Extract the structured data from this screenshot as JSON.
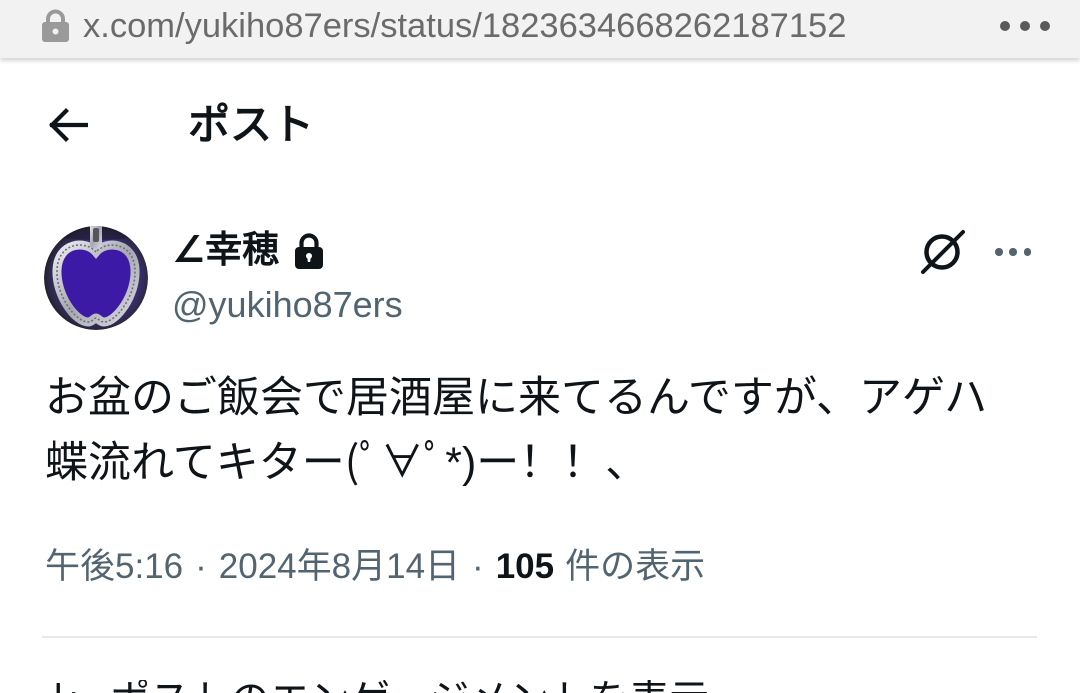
{
  "browser": {
    "url": "x.com/yukiho87ers/status/1823634668262187152",
    "site_info_icon": "lock-icon",
    "menu_icon": "more-horizontal-icon"
  },
  "header": {
    "back_icon": "back-arrow-icon",
    "title": "ポスト"
  },
  "post": {
    "author": {
      "display_name": "∠幸穂",
      "protected_icon": "lock-icon",
      "handle": "@yukiho87ers"
    },
    "actions": {
      "grok_icon": "grok-icon",
      "more_icon": "more-horizontal-icon"
    },
    "text": "お盆のご飯会で居酒屋に来てるんですが、アゲハ蝶流れてキター(ﾟ∀ﾟ*)ー！！、",
    "meta": {
      "time": "午後5:16",
      "separator": "·",
      "date": "2024年8月14日",
      "views_count": "105",
      "views_label": "件の表示"
    },
    "engagements": {
      "icon": "analytics-icon",
      "label": "ポストのエンゲージメントを表示"
    }
  },
  "colors": {
    "page_bg": "#ffffff",
    "url_bar_bg": "#f2f2f2",
    "url_text": "#6b6b6b",
    "url_icon": "#9a9a9a",
    "text_primary": "#0f1419",
    "text_secondary": "#536471",
    "divider": "#e6e9eb"
  }
}
